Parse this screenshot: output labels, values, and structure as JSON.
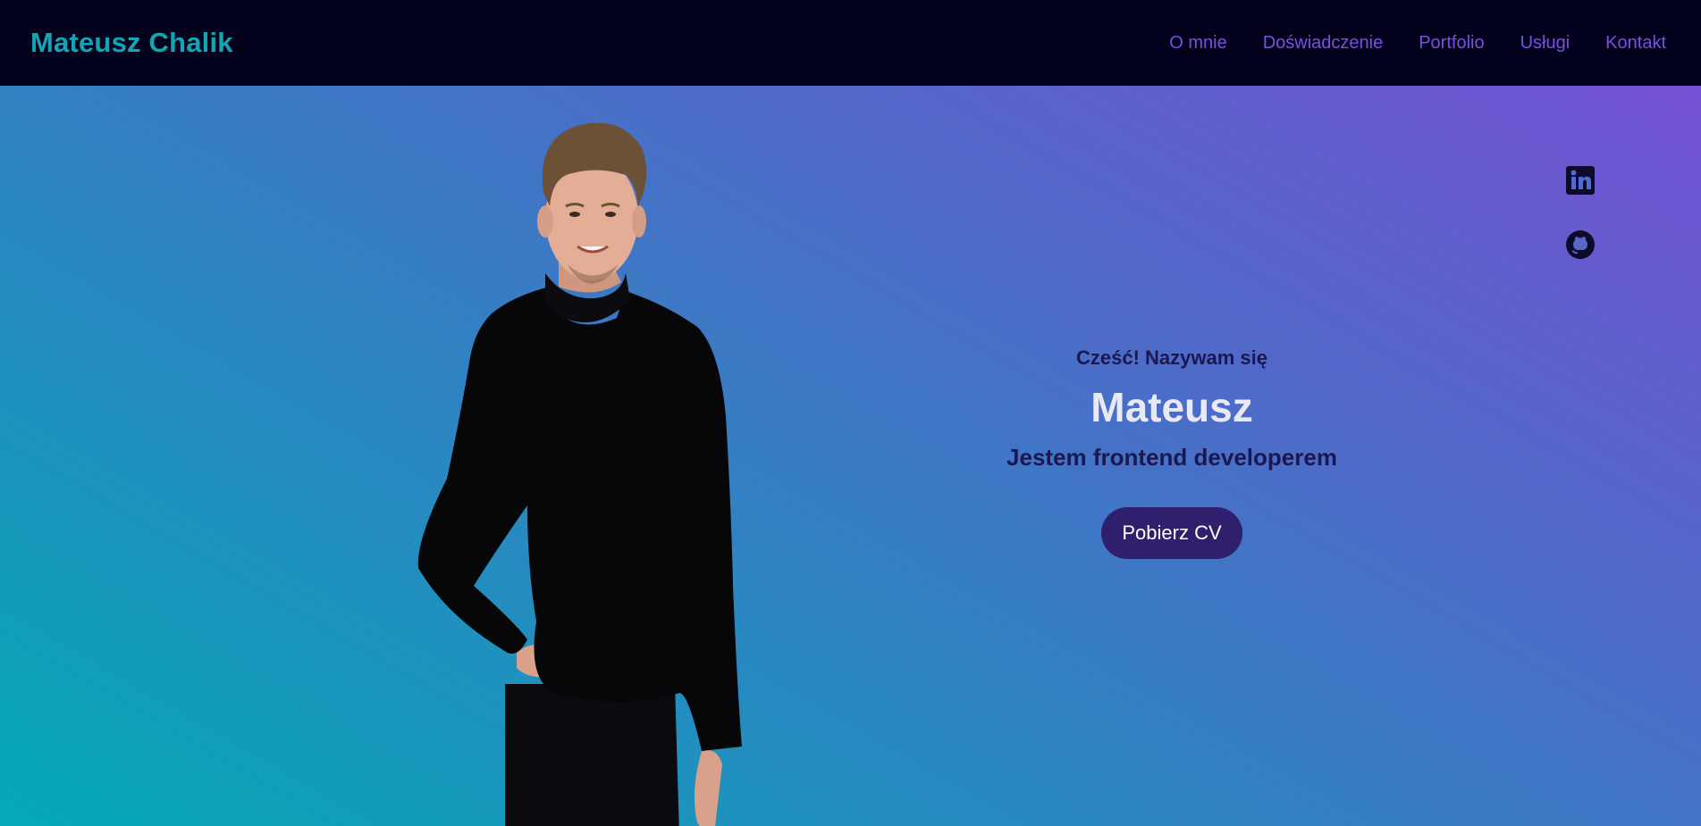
{
  "nav": {
    "logo": "Mateusz Chalik",
    "links": [
      "O mnie",
      "Doświadczenie",
      "Portfolio",
      "Usługi",
      "Kontakt"
    ]
  },
  "hero": {
    "greeting": "Cześć! Nazywam się",
    "name": "Mateusz",
    "role": "Jestem frontend developerem",
    "cv_button": "Pobierz CV"
  },
  "social": [
    "linkedin-icon",
    "github-icon"
  ],
  "colors": {
    "nav_bg": "#03021c",
    "logo": "#12a6b4",
    "nav_link": "#7b4fe0",
    "gradient_start": "#03a9b6",
    "gradient_end": "#7451d4",
    "button_bg": "#2f1f6c",
    "heading_dark": "#1b1750",
    "name_light": "#e9e9f6"
  }
}
